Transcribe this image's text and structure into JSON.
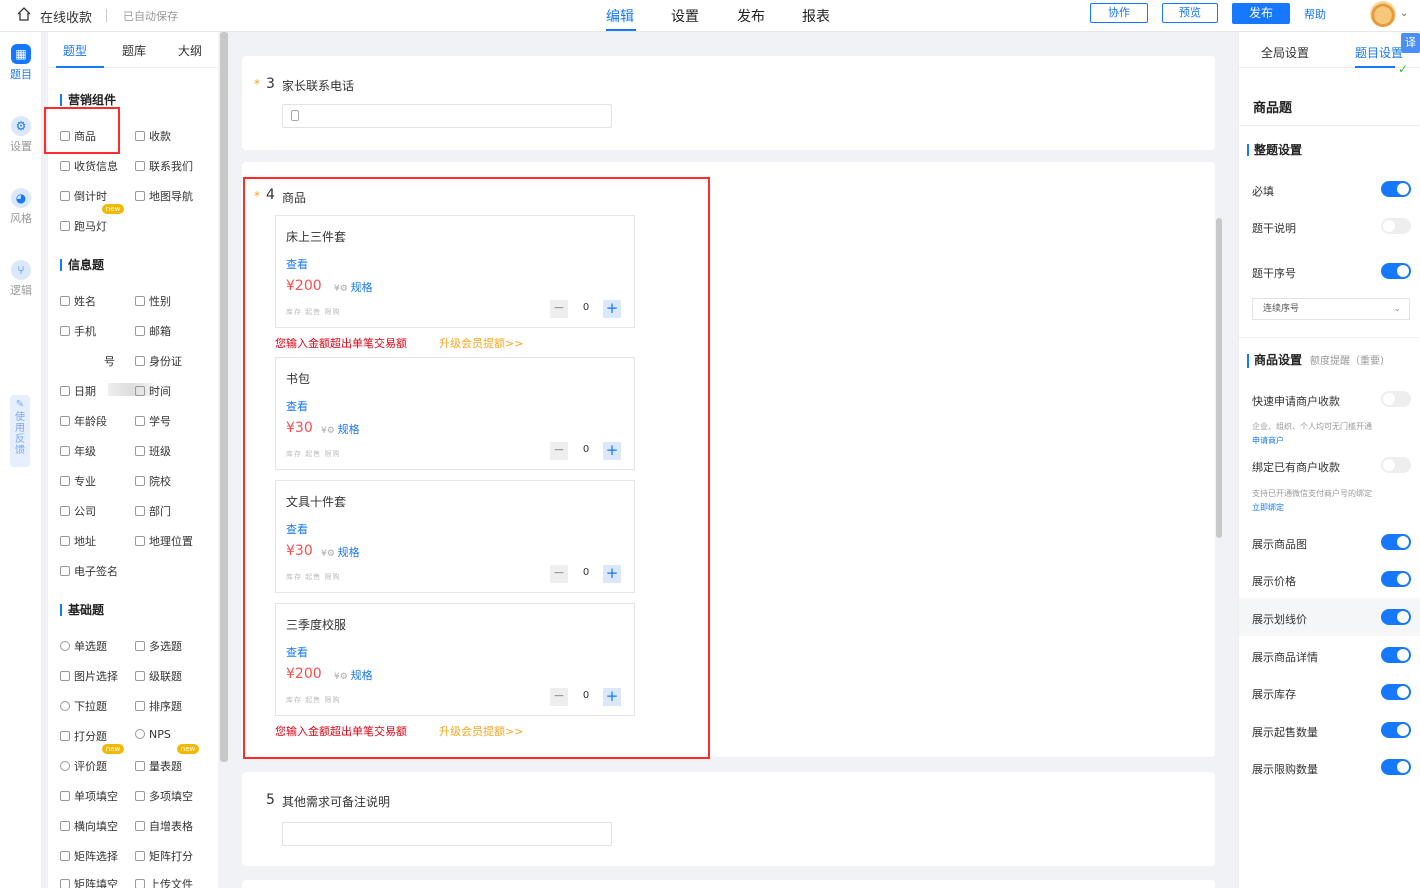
{
  "topbar": {
    "app_title": "在线收款",
    "autosave": "已自动保存",
    "nav": [
      "编辑",
      "设置",
      "发布",
      "报表"
    ],
    "collab": "协作",
    "preview": "预览",
    "publish": "发布",
    "help": "帮助"
  },
  "rail": {
    "items": [
      {
        "label": "题目",
        "icon": "grid-icon"
      },
      {
        "label": "设置",
        "icon": "gear-icon"
      },
      {
        "label": "风格",
        "icon": "palette-icon"
      },
      {
        "label": "逻辑",
        "icon": "logic-icon"
      }
    ],
    "feedback": "使用反馈"
  },
  "palette": {
    "tabs": [
      "题型",
      "题库",
      "大纲"
    ],
    "marketing": {
      "title": "营销组件",
      "items": [
        "商品",
        "收款",
        "收货信息",
        "联系我们",
        "倒计时",
        "地图导航",
        "跑马灯"
      ]
    },
    "info": {
      "title": "信息题",
      "items": [
        "姓名",
        "性别",
        "手机",
        "邮箱",
        "号",
        "身份证",
        "日期",
        "时间",
        "年龄段",
        "学号",
        "年级",
        "班级",
        "专业",
        "院校",
        "公司",
        "部门",
        "地址",
        "地理位置",
        "电子签名"
      ]
    },
    "basic": {
      "title": "基础题",
      "items": [
        "单选题",
        "多选题",
        "图片选择",
        "级联题",
        "下拉题",
        "排序题",
        "打分题",
        "NPS",
        "评价题",
        "量表题",
        "单项填空",
        "多项填空",
        "横向填空",
        "自增表格",
        "矩阵选择",
        "矩阵打分",
        "矩阵填空",
        "上传文件"
      ]
    },
    "badge": "new"
  },
  "canvas": {
    "q3": {
      "num": "3",
      "star": "*",
      "title": "家长联系电话"
    },
    "q4": {
      "num": "4",
      "star": "*",
      "title": "商品"
    },
    "q5": {
      "num": "5",
      "title": "其他需求可备注说明"
    },
    "goods": [
      {
        "name": "床上三件套",
        "view": "查看",
        "price": "¥200",
        "spec": "规格",
        "meta": "库存   起售   限购",
        "qty": "0"
      },
      {
        "name": "书包",
        "view": "查看",
        "price": "¥30",
        "spec": "规格",
        "meta": "库存   起售   限购",
        "qty": "0"
      },
      {
        "name": "文具十件套",
        "view": "查看",
        "price": "¥30",
        "spec": "规格",
        "meta": "库存   起售   限购",
        "qty": "0"
      },
      {
        "name": "三季度校服",
        "view": "查看",
        "price": "¥200",
        "spec": "规格",
        "meta": "库存   起售   限购",
        "qty": "0"
      }
    ],
    "warn": "您输入金额超出单笔交易额",
    "upgrade": "升级会员提额>>"
  },
  "right": {
    "tabs": [
      "全局设置",
      "题目设置"
    ],
    "translate": "译",
    "heading": "商品题",
    "whole_section": "整题设置",
    "required": "必填",
    "stem_desc": "题干说明",
    "stem_num": "题干序号",
    "select_value": "连续序号",
    "goods_section": "商品设置",
    "goods_section_sub": "额度提醒（重要）",
    "quick_apply": "快速申请商户收款",
    "quick_hint": "企业、组织、个人均可无门槛开通",
    "quick_link": "申请商户",
    "bind": "绑定已有商户收款",
    "bind_hint": "支持已开通微信支付商户号的绑定",
    "bind_link": "立即绑定",
    "toggles": [
      "展示商品图",
      "展示价格",
      "展示划线价",
      "展示商品详情",
      "展示库存",
      "展示起售数量",
      "展示限购数量"
    ]
  },
  "colors": {
    "accent": "#1677ff",
    "warn": "#e60012",
    "price": "#ff4d4f",
    "orange": "#f5a623",
    "highlight": "#ff2a2a"
  }
}
